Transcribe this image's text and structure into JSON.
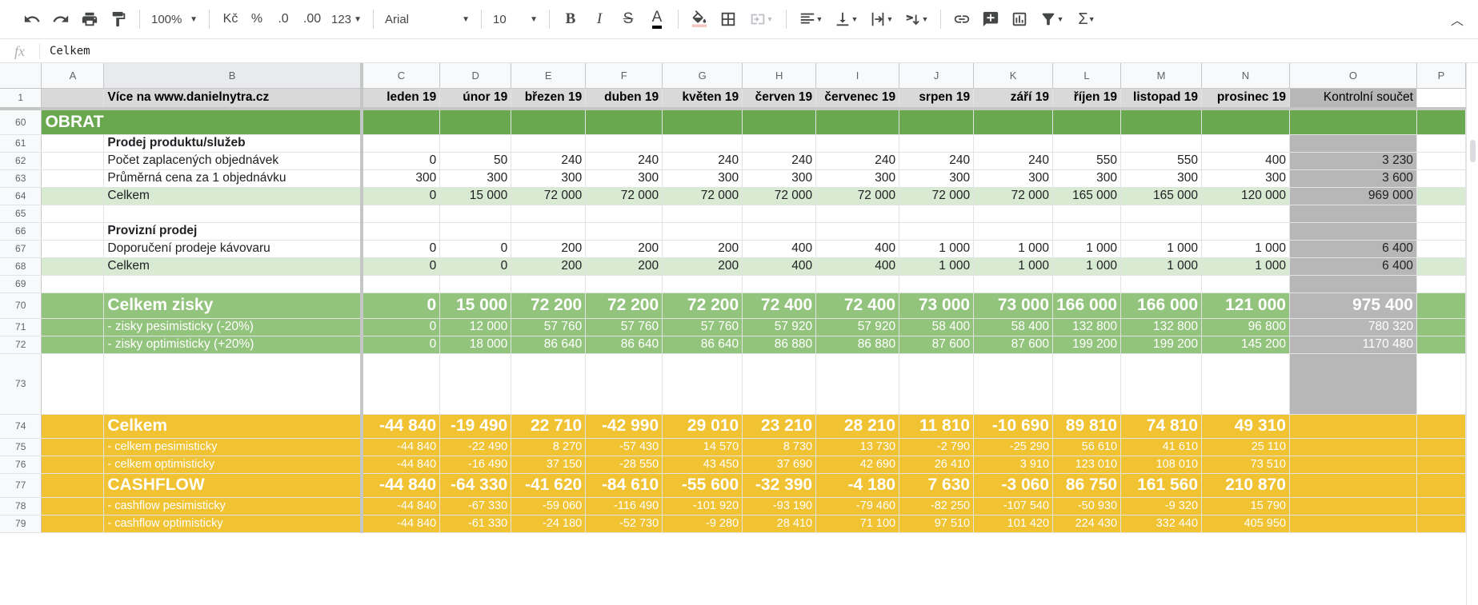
{
  "toolbar": {
    "zoom": "100%",
    "currency": "Kč",
    "percent": "%",
    "dec_less": ".0",
    "dec_more": ".00",
    "format": "123",
    "font": "Arial",
    "font_size": "10",
    "bold": "B",
    "italic": "I",
    "strike": "S",
    "text_color": "A",
    "sum": "Σ",
    "icons": [
      "undo-icon",
      "redo-icon",
      "print-icon",
      "paint-format-icon",
      "fill-color-icon",
      "borders-icon",
      "merge-cells-icon",
      "align-left-icon",
      "valign-bottom-icon",
      "text-wrap-icon",
      "text-rotate-icon",
      "link-icon",
      "comment-icon",
      "chart-icon",
      "filter-icon",
      "functions-icon",
      "collapse-icon"
    ]
  },
  "formula": {
    "fx": "fx",
    "value": "Celkem"
  },
  "columns": [
    "A",
    "B",
    "C",
    "D",
    "E",
    "F",
    "G",
    "H",
    "I",
    "J",
    "K",
    "L",
    "M",
    "N",
    "O",
    "P"
  ],
  "header_row": {
    "num": "1",
    "b": "Více na www.danielnytra.cz",
    "months": [
      "leden 19",
      "únor 19",
      "březen 19",
      "duben 19",
      "květen 19",
      "červen 19",
      "červenec 19",
      "srpen 19",
      "září 19",
      "říjen 19",
      "listopad 19",
      "prosinec 19"
    ],
    "o": "Kontrolní součet"
  },
  "rows": {
    "r60": {
      "num": "60",
      "label": "OBRAT"
    },
    "r61": {
      "num": "61",
      "label": "Prodej produktu/služeb"
    },
    "r62": {
      "num": "62",
      "label": "Počet zaplacených objednávek",
      "v": [
        "0",
        "50",
        "240",
        "240",
        "240",
        "240",
        "240",
        "240",
        "240",
        "550",
        "550",
        "400"
      ],
      "o": "3 230"
    },
    "r63": {
      "num": "63",
      "label": "Průměrná cena za 1 objednávku",
      "v": [
        "300",
        "300",
        "300",
        "300",
        "300",
        "300",
        "300",
        "300",
        "300",
        "300",
        "300",
        "300"
      ],
      "o": "3 600"
    },
    "r64": {
      "num": "64",
      "label": "Celkem",
      "v": [
        "0",
        "15 000",
        "72 000",
        "72 000",
        "72 000",
        "72 000",
        "72 000",
        "72 000",
        "72 000",
        "165 000",
        "165 000",
        "120 000"
      ],
      "o": "969 000"
    },
    "r65": {
      "num": "65"
    },
    "r66": {
      "num": "66",
      "label": "Provizní prodej"
    },
    "r67": {
      "num": "67",
      "label": "Doporučení prodeje kávovaru",
      "v": [
        "0",
        "0",
        "200",
        "200",
        "200",
        "400",
        "400",
        "1 000",
        "1 000",
        "1 000",
        "1 000",
        "1 000"
      ],
      "o": "6 400"
    },
    "r68": {
      "num": "68",
      "label": "Celkem",
      "v": [
        "0",
        "0",
        "200",
        "200",
        "200",
        "400",
        "400",
        "1 000",
        "1 000",
        "1 000",
        "1 000",
        "1 000"
      ],
      "o": "6 400"
    },
    "r69": {
      "num": "69"
    },
    "r70": {
      "num": "70",
      "label": "Celkem zisky",
      "v": [
        "0",
        "15 000",
        "72 200",
        "72 200",
        "72 200",
        "72 400",
        "72 400",
        "73 000",
        "73 000",
        "166 000",
        "166 000",
        "121 000"
      ],
      "o": "975 400"
    },
    "r71": {
      "num": "71",
      "label": "- zisky pesimisticky (-20%)",
      "v": [
        "0",
        "12 000",
        "57 760",
        "57 760",
        "57 760",
        "57 920",
        "57 920",
        "58 400",
        "58 400",
        "132 800",
        "132 800",
        "96 800"
      ],
      "o": "780 320"
    },
    "r72": {
      "num": "72",
      "label": "- zisky optimisticky (+20%)",
      "v": [
        "0",
        "18 000",
        "86 640",
        "86 640",
        "86 640",
        "86 880",
        "86 880",
        "87 600",
        "87 600",
        "199 200",
        "199 200",
        "145 200"
      ],
      "o": "1170 480"
    },
    "r73": {
      "num": "73"
    },
    "r74": {
      "num": "74",
      "label": "Celkem",
      "v": [
        "-44 840",
        "-19 490",
        "22 710",
        "-42 990",
        "29 010",
        "23 210",
        "28 210",
        "11 810",
        "-10 690",
        "89 810",
        "74 810",
        "49 310"
      ]
    },
    "r75": {
      "num": "75",
      "label": "- celkem pesimisticky",
      "v": [
        "-44 840",
        "-22 490",
        "8 270",
        "-57 430",
        "14 570",
        "8 730",
        "13 730",
        "-2 790",
        "-25 290",
        "56 610",
        "41 610",
        "25 110"
      ]
    },
    "r76": {
      "num": "76",
      "label": "- celkem optimisticky",
      "v": [
        "-44 840",
        "-16 490",
        "37 150",
        "-28 550",
        "43 450",
        "37 690",
        "42 690",
        "26 410",
        "3 910",
        "123 010",
        "108 010",
        "73 510"
      ]
    },
    "r77": {
      "num": "77",
      "label": "CASHFLOW",
      "v": [
        "-44 840",
        "-64 330",
        "-41 620",
        "-84 610",
        "-55 600",
        "-32 390",
        "-4 180",
        "7 630",
        "-3 060",
        "86 750",
        "161 560",
        "210 870"
      ]
    },
    "r78": {
      "num": "78",
      "label": "- cashflow pesimisticky",
      "v": [
        "-44 840",
        "-67 330",
        "-59 060",
        "-116 490",
        "-101 920",
        "-93 190",
        "-79 460",
        "-82 250",
        "-107 540",
        "-50 930",
        "-9 320",
        "15 790"
      ]
    },
    "r79": {
      "num": "79",
      "label": "- cashflow optimisticky",
      "v": [
        "-44 840",
        "-61 330",
        "-24 180",
        "-52 730",
        "-9 280",
        "28 410",
        "71 100",
        "97 510",
        "101 420",
        "224 430",
        "332 440",
        "405 950"
      ]
    }
  },
  "colors": {
    "green_dark": "#6aa84f",
    "green_mid": "#93c47d",
    "green_light": "#d9ead3",
    "yellow": "#f1c232",
    "grey": "#b7b7b7"
  }
}
